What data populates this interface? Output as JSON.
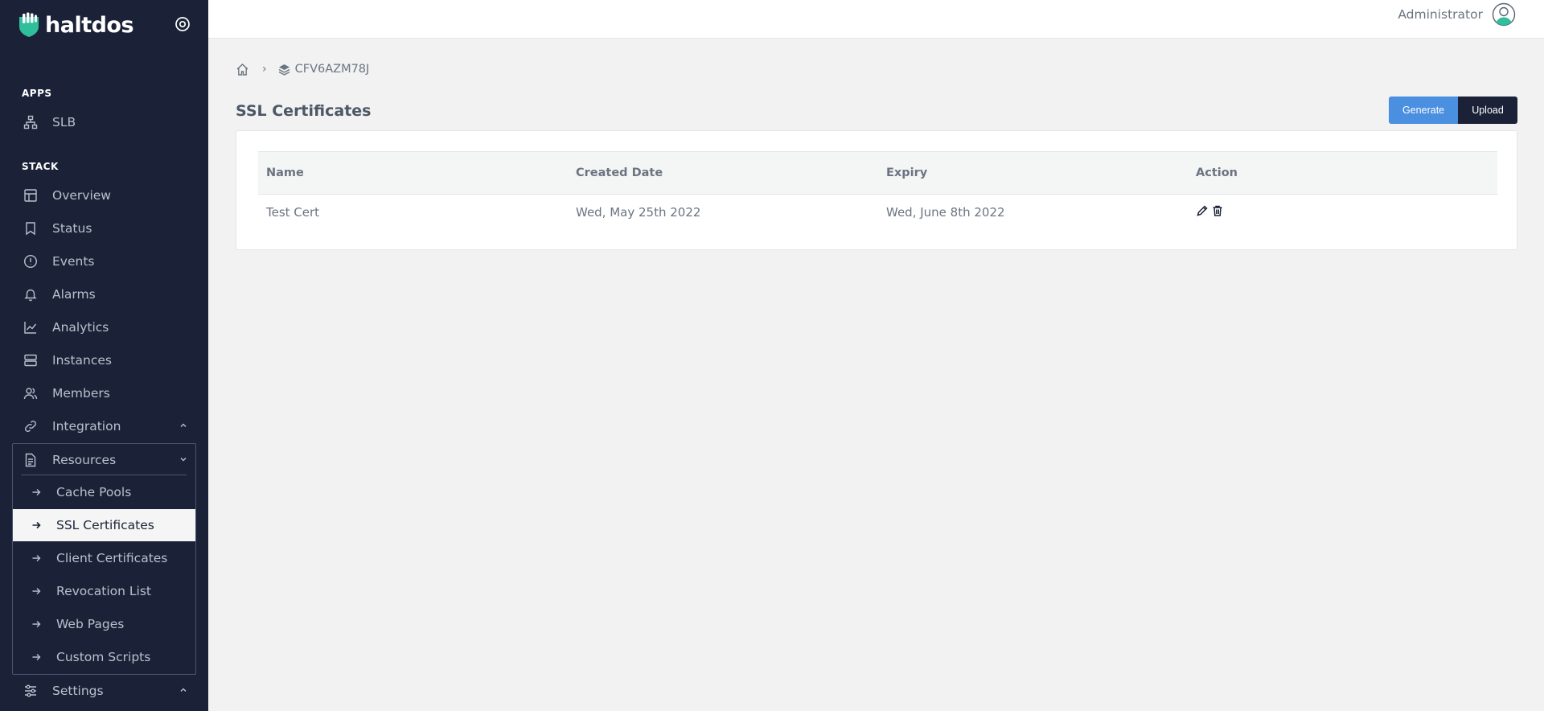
{
  "brand": {
    "name": "haltdos"
  },
  "sidebar": {
    "apps_title": "APPS",
    "apps": [
      {
        "label": "SLB",
        "icon": "sitemap-icon"
      }
    ],
    "stack_title": "STACK",
    "stack": [
      {
        "label": "Overview",
        "icon": "layout-icon"
      },
      {
        "label": "Status",
        "icon": "bookmark-icon"
      },
      {
        "label": "Events",
        "icon": "alert-circle-icon"
      },
      {
        "label": "Alarms",
        "icon": "bell-icon"
      },
      {
        "label": "Analytics",
        "icon": "chart-line-icon"
      },
      {
        "label": "Instances",
        "icon": "server-icon"
      },
      {
        "label": "Members",
        "icon": "users-icon"
      },
      {
        "label": "Integration",
        "icon": "link-icon"
      },
      {
        "label": "Resources",
        "icon": "file-icon"
      }
    ],
    "resources": [
      {
        "label": "Cache Pools"
      },
      {
        "label": "SSL Certificates"
      },
      {
        "label": "Client Certificates"
      },
      {
        "label": "Revocation List"
      },
      {
        "label": "Web Pages"
      },
      {
        "label": "Custom Scripts"
      }
    ],
    "active_resource": "SSL Certificates",
    "settings": {
      "label": "Settings",
      "icon": "sliders-icon"
    }
  },
  "topbar": {
    "user": "Administrator"
  },
  "breadcrumb": {
    "stack": "CFV6AZM78J",
    "separator": "›"
  },
  "page": {
    "title": "SSL Certificates"
  },
  "actions": {
    "generate": "Generate",
    "upload": "Upload"
  },
  "table": {
    "headers": [
      "Name",
      "Created Date",
      "Expiry",
      "Action"
    ],
    "rows": [
      {
        "name": "Test Cert",
        "created": "Wed, May 25th 2022",
        "expiry": "Wed, June 8th 2022"
      }
    ]
  },
  "colors": {
    "sidebar_bg": "#1b2238",
    "accent": "#4a8fe0",
    "brand": "#2fbf9b"
  }
}
